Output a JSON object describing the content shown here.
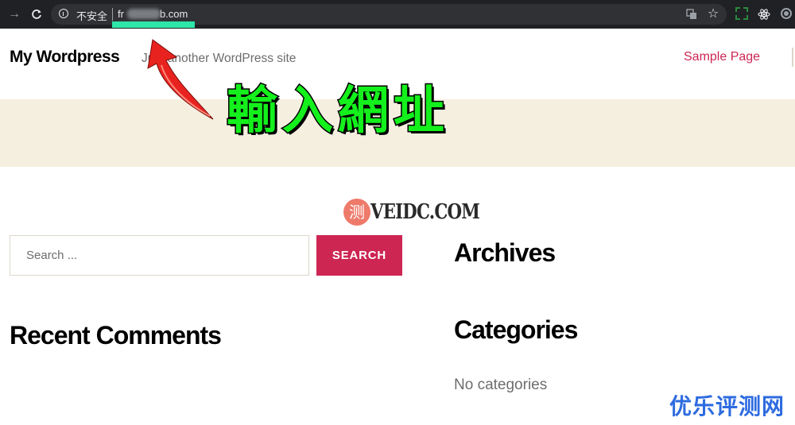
{
  "browser": {
    "not_secure_label": "不安全",
    "url_start": "fr",
    "url_end": "b.com",
    "icons": [
      "back-arrow-icon",
      "reload-icon",
      "info-icon",
      "translate-icon",
      "star-icon",
      "extension-icon",
      "react-icon",
      "ring-icon"
    ]
  },
  "site": {
    "title": "My Wordpress",
    "description": "Just another WordPress site",
    "nav": [
      "Sample Page"
    ]
  },
  "annotation": {
    "text": "輸入網址",
    "text_color": "#14f01c",
    "arrow_color": "#e8231f"
  },
  "watermark": {
    "logo_char": "测",
    "logo_text": "VEIDC.COM",
    "corner_text": "优乐评测网"
  },
  "widgets": {
    "search_placeholder": "Search ...",
    "search_button": "SEARCH",
    "archives_title": "Archives",
    "categories_title": "Categories",
    "no_categories": "No categories",
    "recent_comments_title": "Recent Comments"
  },
  "colors": {
    "accent": "#cd2653",
    "beige": "#f5efe0",
    "browser_bg": "#202124"
  }
}
